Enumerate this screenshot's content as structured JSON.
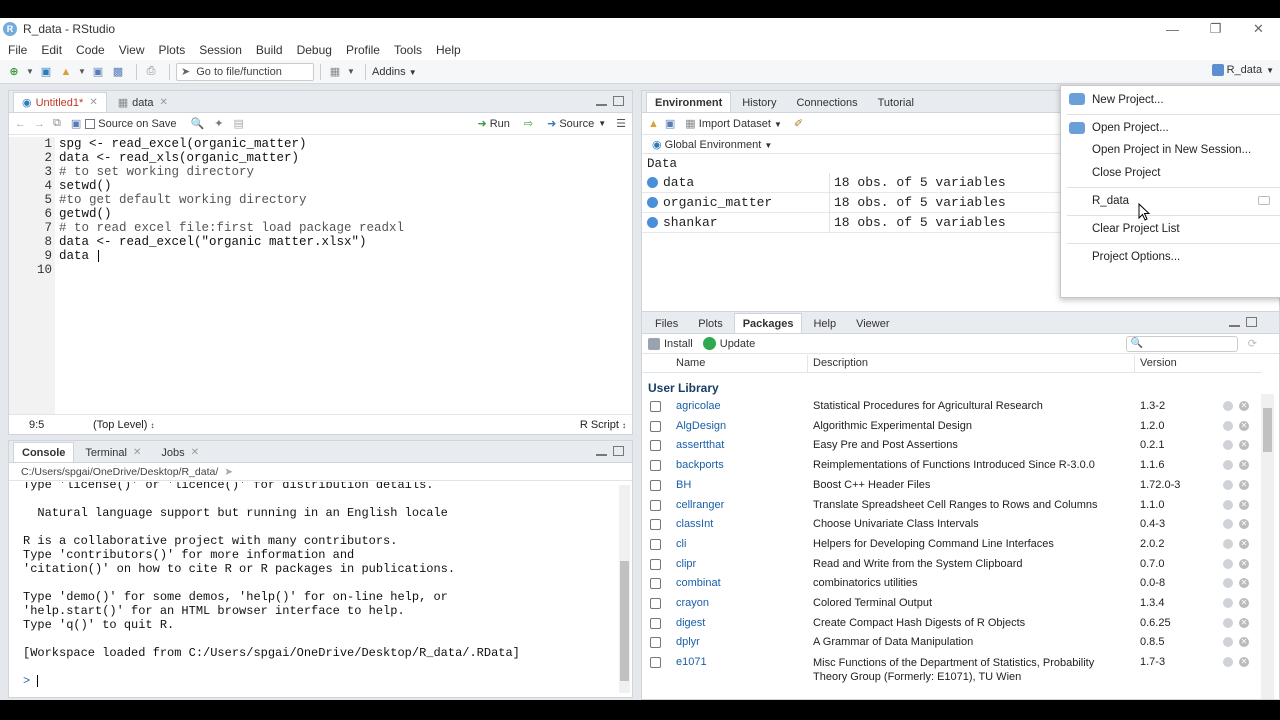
{
  "window": {
    "title": "R_data - RStudio",
    "logo_letter": "R"
  },
  "menu": [
    "File",
    "Edit",
    "Code",
    "View",
    "Plots",
    "Session",
    "Build",
    "Debug",
    "Profile",
    "Tools",
    "Help"
  ],
  "toolbar": {
    "goto_file": "Go to file/function",
    "addins": "Addins",
    "project": "R_data"
  },
  "editor": {
    "tabs": [
      {
        "label": "Untitled1*"
      },
      {
        "label": "data"
      }
    ],
    "source_on_save": "Source on Save",
    "run": "Run",
    "source": "Source",
    "lines": [
      {
        "n": "1",
        "text": "spg <- read_excel(organic_matter)"
      },
      {
        "n": "2",
        "text": "data <- read_xls(organic_matter)"
      },
      {
        "n": "3",
        "text": "# to set working directory"
      },
      {
        "n": "4",
        "text": "setwd()"
      },
      {
        "n": "5",
        "text": "#to get default working directory"
      },
      {
        "n": "6",
        "text": "getwd()"
      },
      {
        "n": "7",
        "text": "# to read excel file:first load package readxl"
      },
      {
        "n": "8",
        "text": "data <- read_excel(\"organic matter.xlsx\")"
      },
      {
        "n": "9",
        "text": "data"
      },
      {
        "n": "10",
        "text": ""
      }
    ],
    "status_pos": "9:5",
    "status_scope": "(Top Level)",
    "status_type": "R Script"
  },
  "console": {
    "tabs": [
      "Console",
      "Terminal",
      "Jobs"
    ],
    "path": "C:/Users/spgai/OneDrive/Desktop/R_data/",
    "lines": [
      "Type 'license()' or 'licence()' for distribution details.",
      "",
      "  Natural language support but running in an English locale",
      "",
      "R is a collaborative project with many contributors.",
      "Type 'contributors()' for more information and",
      "'citation()' on how to cite R or R packages in publications.",
      "",
      "Type 'demo()' for some demos, 'help()' for on-line help, or",
      "'help.start()' for an HTML browser interface to help.",
      "Type 'q()' to quit R.",
      "",
      "[Workspace loaded from C:/Users/spgai/OneDrive/Desktop/R_data/.RData]",
      "",
      ""
    ],
    "prompt": ">"
  },
  "environment": {
    "tabs": [
      "Environment",
      "History",
      "Connections",
      "Tutorial"
    ],
    "import_dataset": "Import Dataset",
    "scope": "Global Environment",
    "section": "Data",
    "rows": [
      {
        "name": "data",
        "value": "18 obs. of 5 variables"
      },
      {
        "name": "organic_matter",
        "value": "18 obs. of 5 variables"
      },
      {
        "name": "shankar",
        "value": "18 obs. of 5 variables"
      }
    ]
  },
  "project_menu": {
    "items": [
      "New Project...",
      "Open Project...",
      "Open Project in New Session...",
      "Close Project",
      "R_data",
      "Clear Project List",
      "Project Options..."
    ]
  },
  "files": {
    "tabs": [
      "Files",
      "Plots",
      "Packages",
      "Help",
      "Viewer"
    ],
    "install": "Install",
    "update": "Update",
    "columns": {
      "name": "Name",
      "description": "Description",
      "version": "Version"
    },
    "section": "User Library",
    "packages": [
      {
        "name": "agricolae",
        "desc": "Statistical Procedures for Agricultural Research",
        "ver": "1.3-2"
      },
      {
        "name": "AlgDesign",
        "desc": "Algorithmic Experimental Design",
        "ver": "1.2.0"
      },
      {
        "name": "assertthat",
        "desc": "Easy Pre and Post Assertions",
        "ver": "0.2.1"
      },
      {
        "name": "backports",
        "desc": "Reimplementations of Functions Introduced Since R-3.0.0",
        "ver": "1.1.6"
      },
      {
        "name": "BH",
        "desc": "Boost C++ Header Files",
        "ver": "1.72.0-3"
      },
      {
        "name": "cellranger",
        "desc": "Translate Spreadsheet Cell Ranges to Rows and Columns",
        "ver": "1.1.0"
      },
      {
        "name": "classInt",
        "desc": "Choose Univariate Class Intervals",
        "ver": "0.4-3"
      },
      {
        "name": "cli",
        "desc": "Helpers for Developing Command Line Interfaces",
        "ver": "2.0.2"
      },
      {
        "name": "clipr",
        "desc": "Read and Write from the System Clipboard",
        "ver": "0.7.0"
      },
      {
        "name": "combinat",
        "desc": "combinatorics utilities",
        "ver": "0.0-8"
      },
      {
        "name": "crayon",
        "desc": "Colored Terminal Output",
        "ver": "1.3.4"
      },
      {
        "name": "digest",
        "desc": "Create Compact Hash Digests of R Objects",
        "ver": "0.6.25"
      },
      {
        "name": "dplyr",
        "desc": "A Grammar of Data Manipulation",
        "ver": "0.8.5"
      },
      {
        "name": "e1071",
        "desc": "Misc Functions of the Department of Statistics, Probability Theory Group (Formerly: E1071), TU Wien",
        "ver": "1.7-3"
      }
    ]
  }
}
